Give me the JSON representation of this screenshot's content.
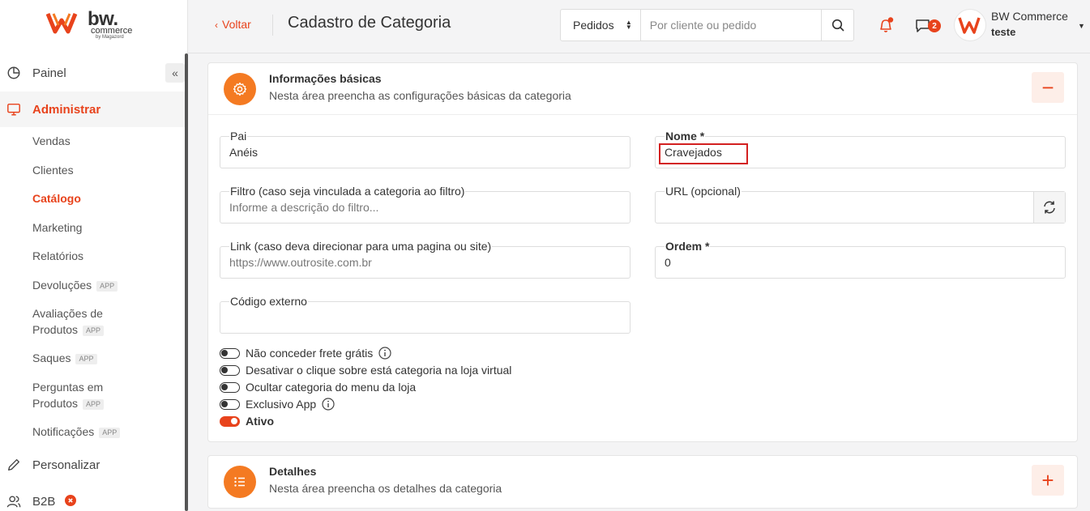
{
  "sidebar": {
    "logo_text": "bw.",
    "logo_sub": "commerce",
    "logo_by": "by Magazord",
    "nav": [
      {
        "label": "Painel",
        "icon": "pie-chart-icon"
      },
      {
        "label": "Administrar",
        "icon": "monitor-icon",
        "active": true
      }
    ],
    "sub_items": [
      {
        "label": "Vendas"
      },
      {
        "label": "Clientes"
      },
      {
        "label": "Catálogo",
        "active": true
      },
      {
        "label": "Marketing"
      },
      {
        "label": "Relatórios"
      },
      {
        "label": "Devoluções",
        "badge": "APP"
      },
      {
        "label_line1": "Avaliações de",
        "label_line2": "Produtos",
        "badge": "APP"
      },
      {
        "label": "Saques",
        "badge": "APP"
      },
      {
        "label_line1": "Perguntas em",
        "label_line2": "Produtos",
        "badge": "APP"
      },
      {
        "label": "Notificações",
        "badge": "APP"
      }
    ],
    "nav_bottom": [
      {
        "label": "Personalizar",
        "icon": "pencil-icon"
      },
      {
        "label": "B2B",
        "icon": "users-icon"
      }
    ]
  },
  "header": {
    "back_label": "Voltar",
    "title": "Cadastro de Categoria",
    "search_select": "Pedidos",
    "search_placeholder": "Por cliente ou pedido",
    "chat_badge": "2",
    "user_name": "BW Commerce",
    "user_sub": "teste"
  },
  "basic_card": {
    "title": "Informações básicas",
    "desc": "Nesta área preencha as configurações básicas da categoria",
    "toggle": "−",
    "fields": {
      "pai": {
        "label": "Pai",
        "value": "Anéis"
      },
      "nome": {
        "label": "Nome *",
        "value": "Cravejados"
      },
      "filtro": {
        "label": "Filtro (caso seja vinculada a categoria ao filtro)",
        "placeholder": "Informe a descrição do filtro..."
      },
      "url": {
        "label": "URL (opcional)",
        "value": ""
      },
      "link": {
        "label": "Link (caso deva direcionar para uma pagina ou site)",
        "placeholder": "https://www.outrosite.com.br"
      },
      "ordem": {
        "label": "Ordem *",
        "value": "0"
      },
      "codigo": {
        "label": "Código externo",
        "value": ""
      }
    },
    "switches": [
      {
        "label": "Não conceder frete grátis",
        "on": false,
        "info": true
      },
      {
        "label": "Desativar o clique sobre está categoria na loja virtual",
        "on": false
      },
      {
        "label": "Ocultar categoria do menu da loja",
        "on": false
      },
      {
        "label": "Exclusivo App",
        "on": false,
        "info": true
      },
      {
        "label": "Ativo",
        "on": true
      }
    ]
  },
  "details_card": {
    "title": "Detalhes",
    "desc": "Nesta área preencha os detalhes da categoria",
    "toggle": "+"
  },
  "colors": {
    "accent": "#e8431c",
    "icon_bg": "#f47a22"
  }
}
